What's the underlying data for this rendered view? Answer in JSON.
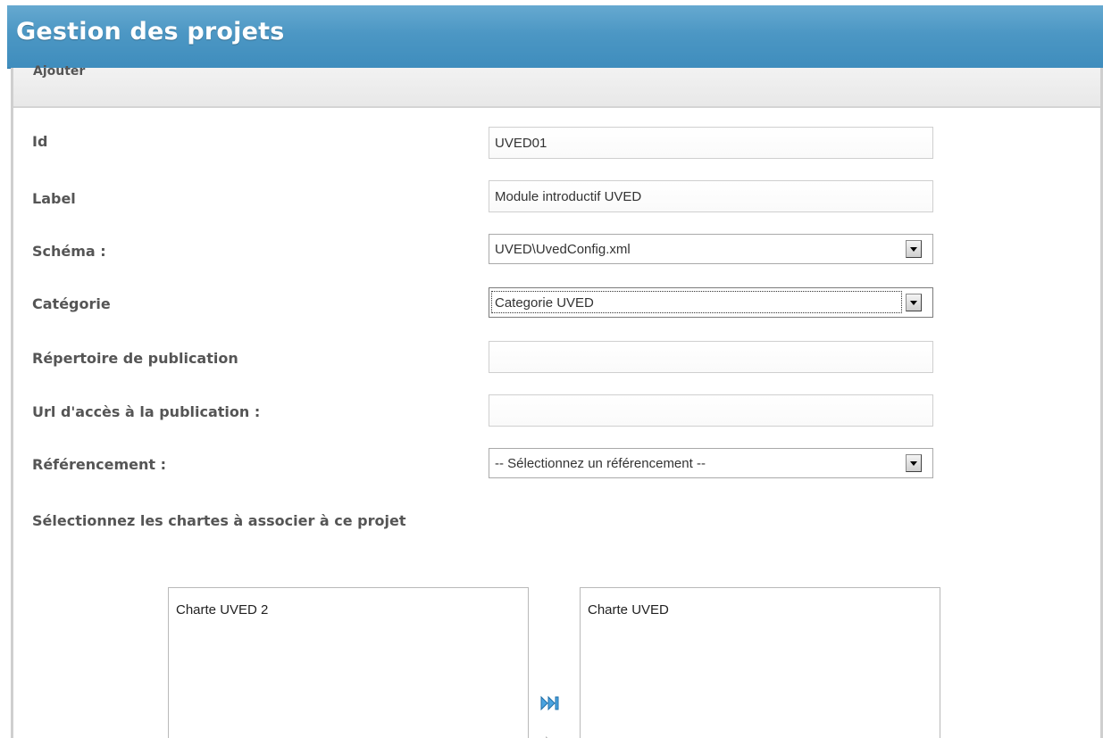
{
  "header": {
    "title": "Gestion des projets"
  },
  "panel": {
    "section_label": "Ajouter"
  },
  "form": {
    "id": {
      "label": "Id",
      "value": "UVED01"
    },
    "label_field": {
      "label": "Label",
      "value": "Module introductif UVED"
    },
    "schema": {
      "label": "Schéma :",
      "selected": "UVED\\UvedConfig.xml"
    },
    "category": {
      "label": "Catégorie",
      "selected": "Categorie UVED"
    },
    "publication_dir": {
      "label": "Répertoire de publication",
      "value": ""
    },
    "publication_url": {
      "label": "Url d'accès à la publication :",
      "value": ""
    },
    "referencing": {
      "label": "Référencement :",
      "selected": "-- Sélectionnez un référencement --"
    }
  },
  "charters": {
    "instruction": "Sélectionnez les chartes à associer à ce projet",
    "available": [
      "Charte UVED 2"
    ],
    "selected": [
      "Charte UVED"
    ]
  },
  "icons": {
    "move_all": "fast-forward-icon",
    "move_one": "play-icon",
    "dropdown": "chevron-down-icon"
  },
  "colors": {
    "header_bg": "#4c97c4",
    "label_text": "#555555"
  }
}
